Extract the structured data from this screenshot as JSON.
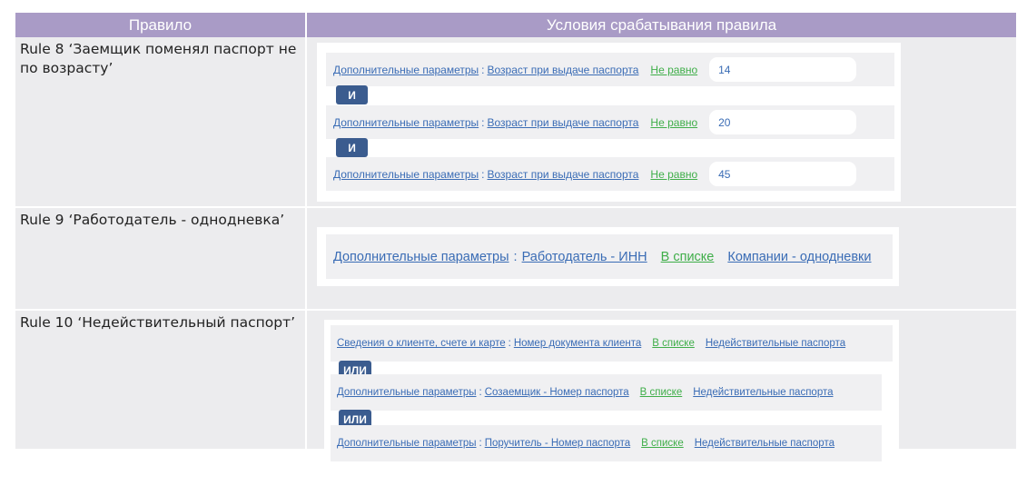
{
  "header": {
    "rule_col": "Правило",
    "cond_col": "Условия срабатывания правила"
  },
  "rules": [
    {
      "title": "Rule 8 ‘Заемщик поменял паспорт не по возрасту’",
      "conditions": [
        {
          "param": "Дополнительные параметры",
          "field": "Возраст при выдаче паспорта",
          "operator": "Не равно",
          "value": "14"
        },
        {
          "param": "Дополнительные параметры",
          "field": "Возраст при выдаче паспорта",
          "operator": "Не равно",
          "value": "20"
        },
        {
          "param": "Дополнительные параметры",
          "field": "Возраст при выдаче паспорта",
          "operator": "Не равно",
          "value": "45"
        }
      ],
      "joiner": "И"
    },
    {
      "title": "Rule 9 ‘Работодатель - однодневка’",
      "conditions": [
        {
          "param": "Дополнительные параметры",
          "field": "Работодатель - ИНН",
          "operator": "В списке",
          "value": "Компании - однодневки"
        }
      ]
    },
    {
      "title": "Rule 10 ‘Недействительный паспорт’",
      "conditions": [
        {
          "param": "Сведения о клиенте, счете и карте",
          "field": "Номер документа клиента",
          "operator": "В списке",
          "value": "Недействительные паспорта"
        },
        {
          "param": "Дополнительные параметры",
          "field": "Созаемщик - Номер паспорта",
          "operator": "В списке",
          "value": "Недействительные паспорта"
        },
        {
          "param": "Дополнительные параметры",
          "field": "Поручитель - Номер паспорта",
          "operator": "В списке",
          "value": "Недействительные паспорта"
        }
      ],
      "joiner": "ИЛИ"
    }
  ],
  "colors": {
    "header": "#a99bc6",
    "link": "#3a6cb5",
    "operator": "#3fae49",
    "joiner": "#3b5c8f"
  }
}
